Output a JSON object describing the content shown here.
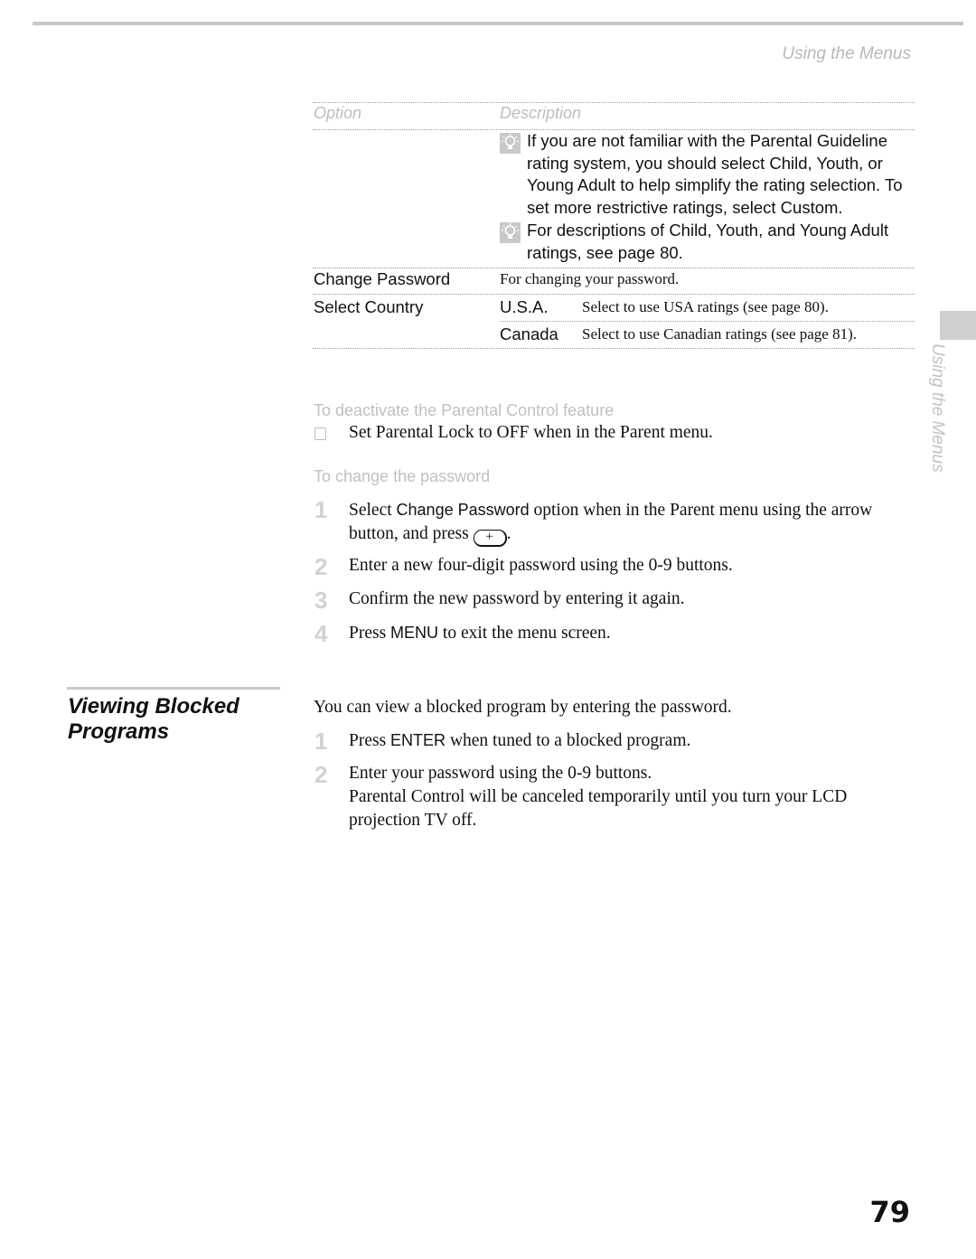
{
  "header": {
    "running_title": "Using the Menus"
  },
  "table": {
    "columns": [
      "Option",
      "Description"
    ],
    "tips": [
      "If you are not familiar with the Parental Guideline rating system, you should select Child, Youth, or Young Adult to help simplify the rating selection. To set more restrictive ratings, select Custom.",
      "For descriptions of Child, Youth, and Young Adult ratings, see page 80."
    ],
    "rows": [
      {
        "option": "Change Password",
        "description": "For changing your password."
      },
      {
        "option": "Select Country",
        "sub": [
          {
            "label": "U.S.A.",
            "description": "Select to use USA ratings (see page 80)."
          },
          {
            "label": "Canada",
            "description": "Select to use Canadian ratings (see page 81)."
          }
        ]
      }
    ]
  },
  "deactivate": {
    "heading": "To deactivate the Parental Control feature",
    "bullet": "Set Parental Lock to OFF when in the Parent menu."
  },
  "change_password": {
    "heading": "To change the password",
    "steps": [
      {
        "num": "1",
        "pre": "Select ",
        "term": "Change Password",
        "post": " option when in the Parent menu using the arrow button, and press",
        "button_icon": "plus-button-icon",
        "button_glyph": "+",
        "end": "."
      },
      {
        "num": "2",
        "text": "Enter a new four-digit password using the 0-9 buttons."
      },
      {
        "num": "3",
        "text": "Confirm the new password by entering it again."
      },
      {
        "num": "4",
        "pre": "Press ",
        "term": "MENU",
        "post": " to exit the menu screen."
      }
    ]
  },
  "viewing_blocked": {
    "heading_line1": "Viewing Blocked",
    "heading_line2": "Programs",
    "intro": "You can view a blocked program by entering the password.",
    "steps": [
      {
        "num": "1",
        "pre": "Press ",
        "term": "ENTER",
        "post": " when tuned to a blocked program."
      },
      {
        "num": "2",
        "text": "Enter your password using the 0-9 buttons.",
        "note": "Parental Control will be canceled temporarily until you turn your LCD projection TV off."
      }
    ]
  },
  "side_tab": {
    "label": "Using the Menus"
  },
  "footer": {
    "page_number": "79"
  }
}
